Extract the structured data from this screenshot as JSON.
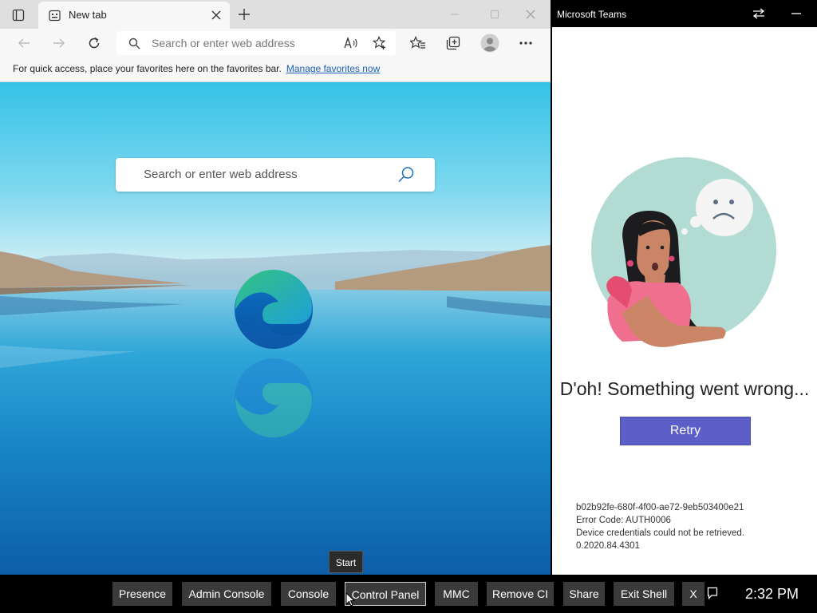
{
  "browser": {
    "tab_title": "New tab",
    "address_placeholder": "Search or enter web address",
    "favbar_text": "For quick access, place your favorites here on the favorites bar.",
    "favbar_link": "Manage favorites now",
    "ntp_search_placeholder": "Search or enter web address"
  },
  "teams": {
    "window_title": "Microsoft Teams",
    "error_title": "D'oh! Something went wrong...",
    "retry_label": "Retry",
    "error_lines": [
      "b02b92fe-680f-4f00-ae72-9eb503400e21",
      "Error Code: AUTH0006",
      "Device credentials could not be retrieved.",
      "0.2020.84.4301"
    ]
  },
  "taskbar": {
    "user_label": "",
    "buttons": [
      "Presence",
      "Admin Console",
      "Console",
      "Control Panel",
      "MMC",
      "Remove CI",
      "Share",
      "Exit Shell",
      "X"
    ],
    "active_button": "Control Panel",
    "tooltip": "Start",
    "clock": "2:32 PM"
  },
  "colors": {
    "teams_accent": "#5b5fc7",
    "link": "#1a5fb4",
    "taskbar_bg": "#000000",
    "taskbar_button_bg": "#3a3a3a"
  },
  "icons": [
    "tab-actions-icon",
    "new-tab-page-icon",
    "close-icon",
    "plus-icon",
    "minimize-icon",
    "restore-icon",
    "back-icon",
    "forward-icon",
    "refresh-icon",
    "search-icon",
    "read-aloud-icon",
    "add-favorite-icon",
    "favorites-icon",
    "collections-icon",
    "profile-icon",
    "more-icon",
    "edge-logo-icon",
    "swap-icon",
    "notification-icon",
    "cursor-icon"
  ]
}
